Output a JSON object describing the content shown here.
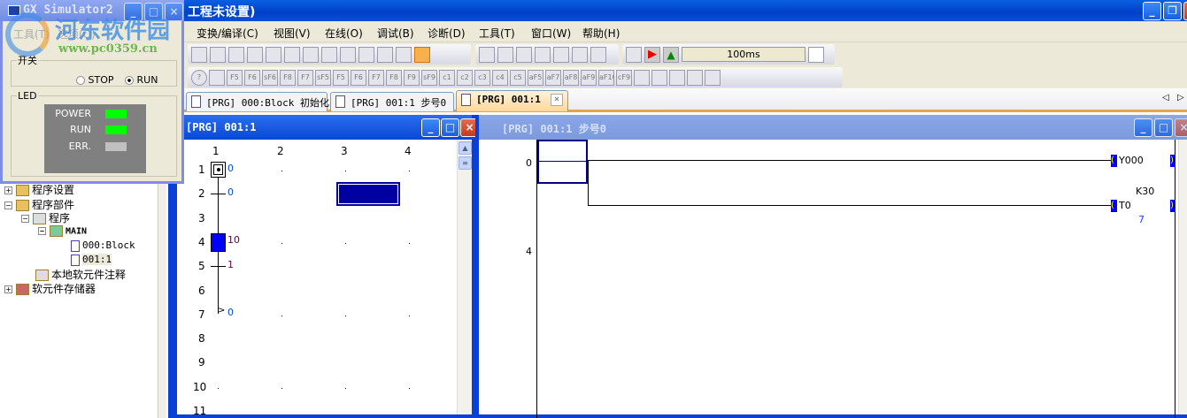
{
  "app": {
    "title": "工程未设置)"
  },
  "menu": [
    "变换/编译(C)",
    "视图(V)",
    "在线(O)",
    "调试(B)",
    "诊断(D)",
    "工具(T)",
    "窗口(W)",
    "帮助(H)"
  ],
  "toolbar": {
    "scan_time": "100ms",
    "row1": [
      "device-batch-icon",
      "monitor-icon",
      "ladder-monitor-icon",
      "write-plc-icon",
      "read-plc-icon",
      "monitor-start-icon",
      "monitor-stop-icon",
      "monitor-all-icon",
      "monitor-write-icon",
      "comment-icon",
      "convert-icon",
      "undo-icon",
      "simulator-icon"
    ],
    "row2": [
      "sfc-step-icon",
      "sfc-transition-icon",
      "sfc-jump-icon",
      "sfc-parallel-icon",
      "sfc-select-icon",
      "sfc-end-icon",
      "sfc-branch-icon"
    ],
    "row3": [
      "f5-contact-icon",
      "f6-contact-icon",
      "sf6-icon",
      "f8-icon",
      "f7-coil-icon",
      "sf5-icon",
      "f5-icon",
      "f6-icon",
      "f7-icon",
      "f8-icon",
      "f9-icon",
      "sf9-icon",
      "c1-icon",
      "c2-icon",
      "c3-icon",
      "c4-icon",
      "c5-icon",
      "af5-icon",
      "af7-icon",
      "af8-icon",
      "af9-icon",
      "af10-icon",
      "cf9-icon",
      "edit-icon",
      "step-icon",
      "table-icon",
      "device-search-icon",
      "zoom-icon"
    ],
    "row3_labels": [
      "F5",
      "F6",
      "sF6",
      "F8",
      "F7",
      "sF5",
      "F5",
      "F6",
      "F7",
      "F8",
      "F9",
      "sF9",
      "c1",
      "c2",
      "c3",
      "c4",
      "c5",
      "aF5",
      "aF7",
      "aF8",
      "aF9",
      "aF10",
      "cF9",
      "",
      "",
      "",
      "",
      ""
    ]
  },
  "tabs": [
    {
      "label": "[PRG] 000:Block 初始化"
    },
    {
      "label": "[PRG] 001:1 步号0"
    },
    {
      "label": "[PRG] 001:1",
      "active": true
    }
  ],
  "tree": {
    "items": [
      "程序设置",
      "程序部件",
      "程序",
      "MAIN",
      "000:Block",
      "001:1",
      "本地软元件注释",
      "软元件存储器"
    ]
  },
  "sfc_window": {
    "title": "[PRG] 001:1",
    "columns": [
      "1",
      "2",
      "3",
      "4"
    ],
    "rows": [
      "1",
      "2",
      "3",
      "4",
      "5",
      "6",
      "7",
      "8",
      "9",
      "10",
      "11"
    ],
    "labels": {
      "initial_step": "0",
      "transition1": "0",
      "step": "10",
      "transition2": "1",
      "jump": "0"
    }
  },
  "ladder_window": {
    "title": "[PRG] 001:1 步号0",
    "step_numbers": [
      "0",
      "4"
    ],
    "coil1": "Y000",
    "coil2": "T0",
    "timer_setting": "K30",
    "timer_value": "7"
  },
  "simulator": {
    "title": "GX Simulator2",
    "menu": [
      "工具(T)",
      "选项(O)"
    ],
    "switch_label": "开关",
    "stop": "STOP",
    "run": "RUN",
    "led_label": "LED",
    "leds": [
      {
        "name": "POWER",
        "color": "#00ff00"
      },
      {
        "name": "RUN",
        "color": "#00ff00"
      },
      {
        "name": "ERR.",
        "color": "#c0c0c0"
      }
    ]
  },
  "watermark": {
    "text": "河东软件园",
    "url": "www.pc0359.cn"
  }
}
